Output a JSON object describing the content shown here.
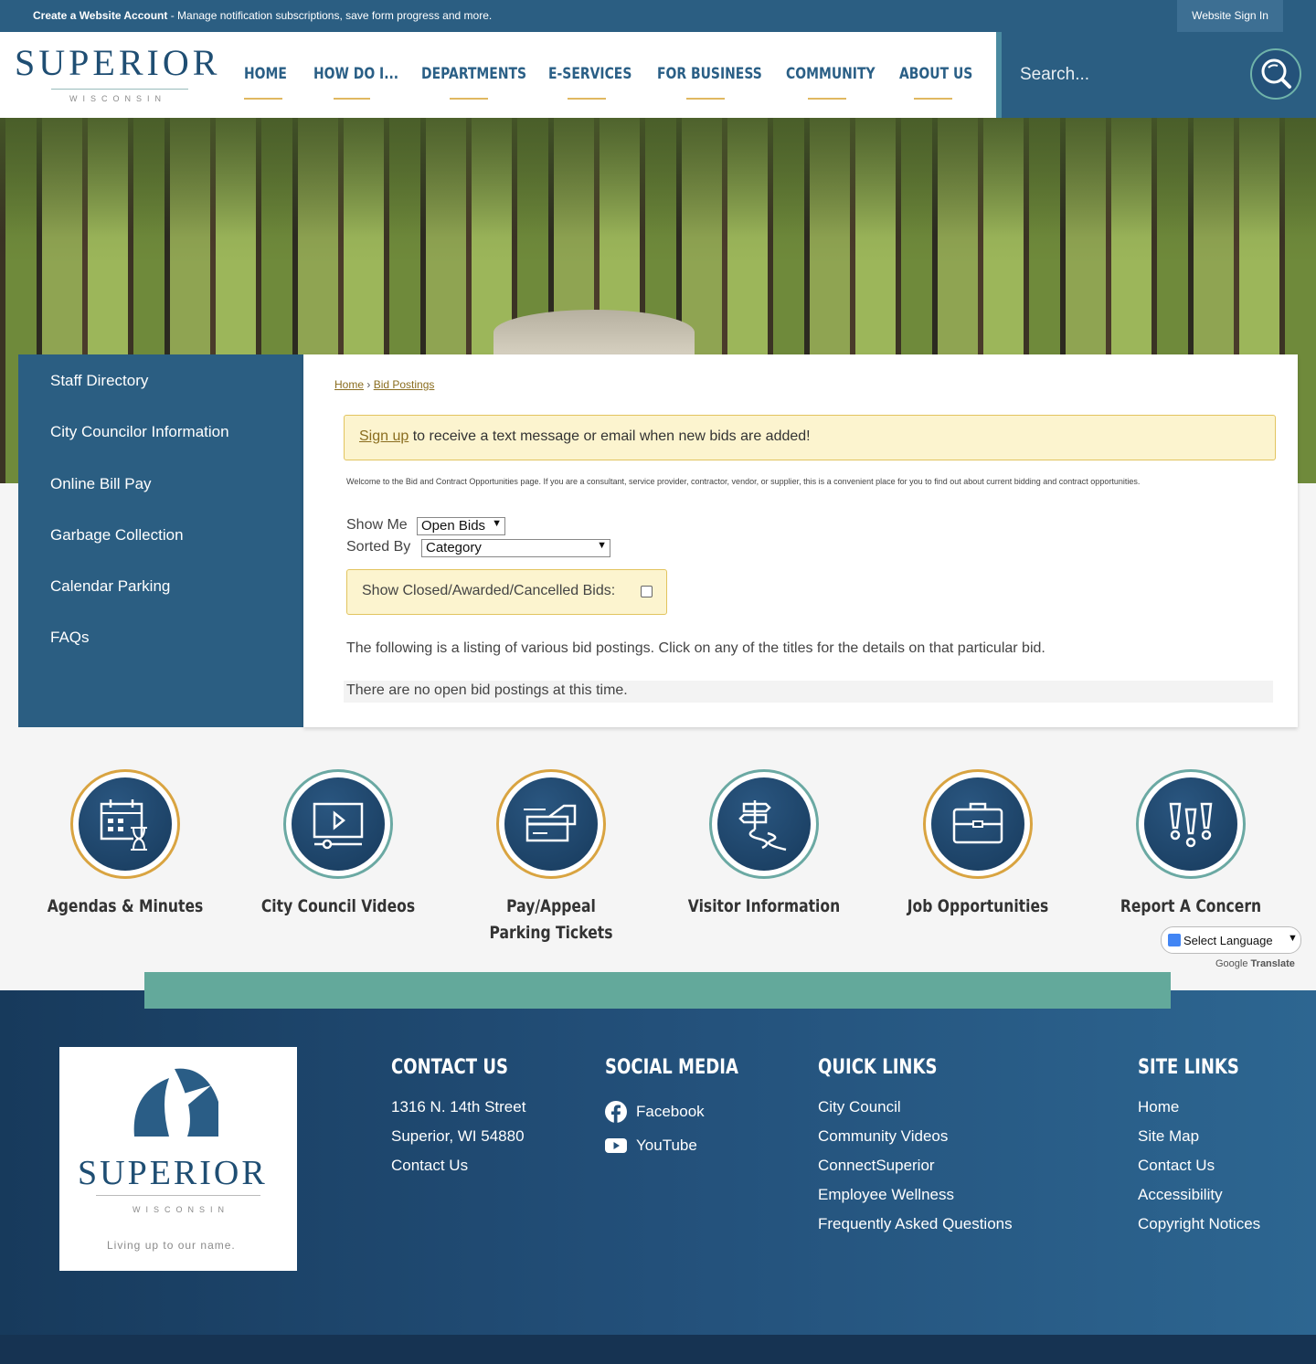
{
  "topbar": {
    "create_bold": "Create a Website Account",
    "create_rest": " - Manage notification subscriptions, save form progress and more.",
    "signin": "Website Sign In"
  },
  "logo": {
    "word": "SUPERIOR",
    "sub": "WISCONSIN"
  },
  "nav": [
    "HOME",
    "HOW DO I...",
    "DEPARTMENTS",
    "E-SERVICES",
    "FOR BUSINESS",
    "COMMUNITY",
    "ABOUT US"
  ],
  "search": {
    "placeholder": "Search..."
  },
  "sidebar": [
    "Staff Directory",
    "City Councilor Information",
    "Online Bill Pay",
    "Garbage Collection",
    "Calendar Parking",
    "FAQs"
  ],
  "breadcrumb": {
    "home": "Home",
    "sep": " › ",
    "current": "Bid Postings"
  },
  "alert": {
    "link": "Sign up",
    "text": " to receive a text message or email when new bids are added!"
  },
  "welcome": "Welcome to the Bid and Contract Opportunities page. If you are a consultant, service provider, contractor, vendor, or supplier, this is a convenient place for you to find out about current bidding and contract opportunities.",
  "filters": {
    "show_me_label": "Show Me",
    "show_me_value": "Open Bids",
    "sorted_by_label": "Sorted By",
    "sorted_by_value": "Category",
    "closed_label": "Show Closed/Awarded/Cancelled Bids:"
  },
  "listing_text": "The following is a listing of various bid postings. Click on any of the titles for the details on that particular bid.",
  "no_bids": "There are no open bid postings at this time.",
  "quick_links": [
    {
      "label": "Agendas & Minutes",
      "icon": "calendar-hourglass-icon"
    },
    {
      "label": "City Council Videos",
      "icon": "video-player-icon"
    },
    {
      "label": "Pay/Appeal Parking Tickets",
      "icon": "payment-card-icon"
    },
    {
      "label": "Visitor Information",
      "icon": "signpost-icon"
    },
    {
      "label": "Job Opportunities",
      "icon": "briefcase-icon"
    },
    {
      "label": "Report A Concern",
      "icon": "exclamation-icon"
    }
  ],
  "translate": {
    "select": "Select Language",
    "powered_google": "Google",
    "powered_translate": "Translate"
  },
  "footer": {
    "logo_word": "SUPERIOR",
    "logo_sub": "WISCONSIN",
    "logo_tag": "Living up to our name.",
    "contact": {
      "title": "CONTACT US",
      "lines": [
        "1316 N. 14th Street",
        "Superior, WI 54880",
        "Contact Us"
      ]
    },
    "social": {
      "title": "SOCIAL MEDIA",
      "items": [
        "Facebook",
        "YouTube"
      ]
    },
    "quick": {
      "title": "QUICK LINKS",
      "items": [
        "City Council",
        "Community Videos",
        "ConnectSuperior",
        "Employee Wellness",
        "Frequently Asked Questions"
      ]
    },
    "site": {
      "title": "SITE LINKS",
      "items": [
        "Home",
        "Site Map",
        "Contact Us",
        "Accessibility",
        "Copyright Notices"
      ]
    }
  },
  "colors": {
    "primary": "#2b5e82",
    "gold": "#d9a441",
    "teal": "#63a99b",
    "alert_bg": "#fcf4cf"
  }
}
